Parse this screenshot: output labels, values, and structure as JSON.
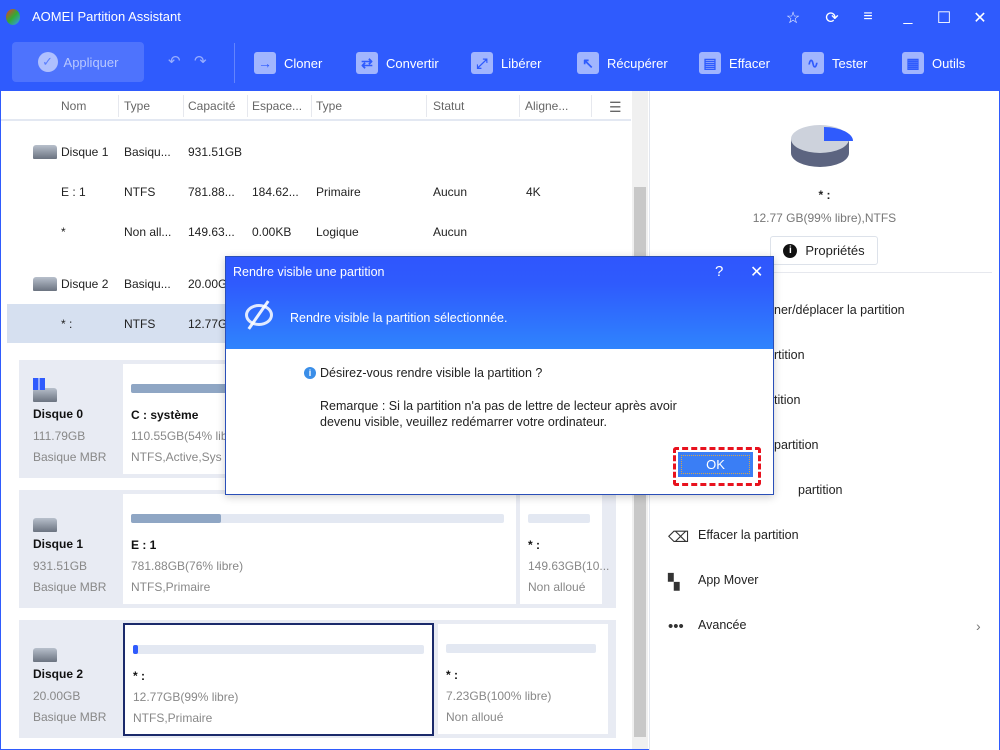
{
  "app": {
    "title": "AOMEI Partition Assistant"
  },
  "toolbar": {
    "apply": "Appliquer",
    "items": [
      "Cloner",
      "Convertir",
      "Libérer",
      "Récupérer",
      "Effacer",
      "Tester",
      "Outils"
    ]
  },
  "table": {
    "headers": [
      "Nom",
      "Type",
      "Capacité",
      "Espace...",
      "Type",
      "Statut",
      "Aligne..."
    ],
    "rows": [
      {
        "name": "Disque 1",
        "type": "Basiqu...",
        "cap": "931.51GB",
        "used": "",
        "ptype": "",
        "status": "",
        "align": ""
      },
      {
        "name": "E : 1",
        "type": "NTFS",
        "cap": "781.88...",
        "used": "184.62...",
        "ptype": "Primaire",
        "status": "Aucun",
        "align": "4K"
      },
      {
        "name": "*",
        "type": "Non all...",
        "cap": "149.63...",
        "used": "0.00KB",
        "ptype": "Logique",
        "status": "Aucun",
        "align": ""
      },
      {
        "name": "Disque 2",
        "type": "Basiqu...",
        "cap": "20.00G",
        "used": "",
        "ptype": "",
        "status": "",
        "align": ""
      },
      {
        "name": "* :",
        "type": "NTFS",
        "cap": "12.77G",
        "used": "",
        "ptype": "",
        "status": "",
        "align": ""
      }
    ]
  },
  "disks": [
    {
      "name": "Disque 0",
      "size": "111.79GB",
      "kind": "Basique MBR",
      "parts": [
        {
          "label": "C : système",
          "info": "110.55GB(54% lib",
          "fs": "NTFS,Active,Sys",
          "used_pct": 46
        }
      ]
    },
    {
      "name": "Disque 1",
      "size": "931.51GB",
      "kind": "Basique MBR",
      "parts": [
        {
          "label": "E : 1",
          "info": "781.88GB(76% libre)",
          "fs": "NTFS,Primaire",
          "used_pct": 24
        },
        {
          "label": "* :",
          "info": "149.63GB(10...",
          "fs": "Non alloué",
          "used_pct": 0
        }
      ]
    },
    {
      "name": "Disque 2",
      "size": "20.00GB",
      "kind": "Basique MBR",
      "parts": [
        {
          "label": "* :",
          "info": "12.77GB(99% libre)",
          "fs": "NTFS,Primaire",
          "used_pct": 1
        },
        {
          "label": "* :",
          "info": "7.23GB(100% libre)",
          "fs": "Non alloué",
          "used_pct": 0
        }
      ]
    }
  ],
  "panel": {
    "name": "* :",
    "info": "12.77 GB(99% libre),NTFS",
    "properties": "Propriétés",
    "items": [
      "ner/déplacer la partition",
      "rtition",
      "tition",
      "partition",
      "partition",
      "Effacer la partition",
      "App Mover",
      "Avancée"
    ]
  },
  "dialog": {
    "title": "Rendre visible une partition",
    "help": "?",
    "header": "Rendre visible la partition sélectionnée.",
    "question": "Désirez-vous rendre visible la partition ?",
    "note1": "Remarque : Si la partition n'a pas de lettre de lecteur après avoir",
    "note2": "devenu visible, veuillez redémarrer votre ordinateur.",
    "ok": "OK"
  }
}
